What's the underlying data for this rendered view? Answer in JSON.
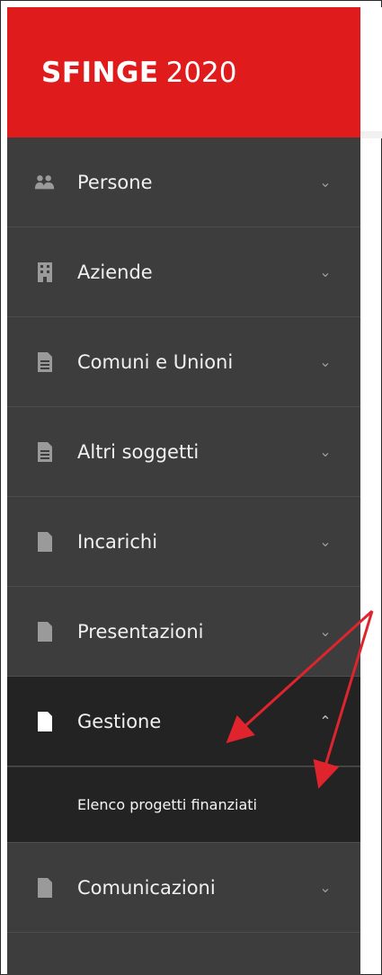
{
  "brand": {
    "name": "SFINGE",
    "year": "2020"
  },
  "nav": {
    "items": [
      {
        "label": "Persone",
        "icon": "users-icon"
      },
      {
        "label": "Aziende",
        "icon": "building-icon"
      },
      {
        "label": "Comuni e Unioni",
        "icon": "document-icon"
      },
      {
        "label": "Altri soggetti",
        "icon": "document-icon"
      },
      {
        "label": "Incarichi",
        "icon": "file-icon"
      },
      {
        "label": "Presentazioni",
        "icon": "file-icon"
      },
      {
        "label": "Gestione",
        "icon": "file-icon",
        "expanded": true
      },
      {
        "label": "Comunicazioni",
        "icon": "file-icon"
      }
    ],
    "gestione_sub": [
      "Elenco progetti finanziati"
    ]
  },
  "colors": {
    "brand_red": "#e01b1c",
    "sidebar_bg": "#3d3d3d",
    "active_bg": "#232323",
    "annotation_red": "#e0242e"
  }
}
